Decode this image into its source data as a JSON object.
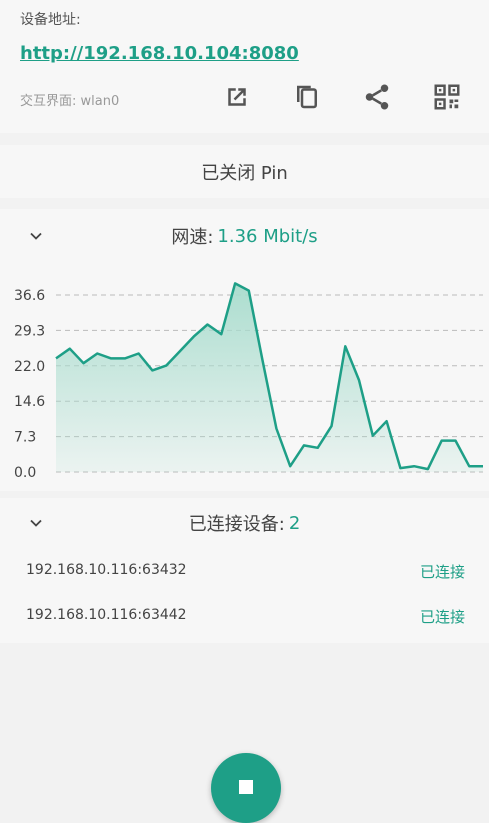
{
  "address": {
    "label": "设备地址:",
    "url": "http://192.168.10.104:8080",
    "interface": "交互界面: wlan0"
  },
  "actions": [
    "open-external-icon",
    "copy-icon",
    "share-icon",
    "qr-code-icon"
  ],
  "pin": {
    "status": "已关闭 Pin"
  },
  "speed": {
    "label": "网速:",
    "value": "1.36 Mbit/s"
  },
  "devices": {
    "label": "已连接设备:",
    "count": "2",
    "items": [
      {
        "address": "192.168.10.116:63432",
        "status": "已连接"
      },
      {
        "address": "192.168.10.116:63442",
        "status": "已连接"
      }
    ]
  },
  "colors": {
    "accent": "#1e9f87",
    "fill": "#a8dccd"
  },
  "chart_data": {
    "type": "area",
    "yticks": [
      "36.6",
      "29.3",
      "22.0",
      "14.6",
      "7.3",
      "0.0"
    ],
    "ylim": [
      0,
      36.6
    ],
    "values": [
      23.5,
      25.5,
      22.5,
      24.5,
      23.5,
      23.5,
      24.5,
      21,
      22,
      25,
      28,
      30.5,
      28.5,
      39,
      37.5,
      23,
      9,
      1.2,
      5.5,
      5,
      9.5,
      26,
      19,
      7.5,
      10.5,
      0.8,
      1.2,
      0.6,
      6.5,
      6.5,
      1.2,
      1.2
    ],
    "grid": true
  }
}
